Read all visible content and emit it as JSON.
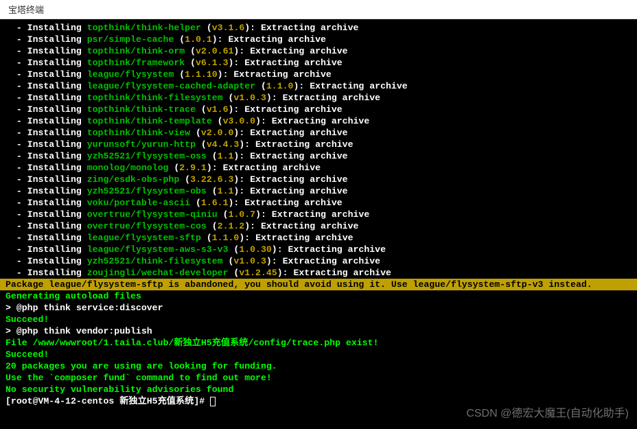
{
  "title": "宝塔终端",
  "installs": [
    {
      "pkg": "topthink/think-helper",
      "ver": "v3.1.6",
      "action": "Extracting archive"
    },
    {
      "pkg": "psr/simple-cache",
      "ver": "1.0.1",
      "action": "Extracting archive"
    },
    {
      "pkg": "topthink/think-orm",
      "ver": "v2.0.61",
      "action": "Extracting archive"
    },
    {
      "pkg": "topthink/framework",
      "ver": "v6.1.3",
      "action": "Extracting archive"
    },
    {
      "pkg": "league/flysystem",
      "ver": "1.1.10",
      "action": "Extracting archive"
    },
    {
      "pkg": "league/flysystem-cached-adapter",
      "ver": "1.1.0",
      "action": "Extracting archive"
    },
    {
      "pkg": "topthink/think-filesystem",
      "ver": "v1.0.3",
      "action": "Extracting archive"
    },
    {
      "pkg": "topthink/think-trace",
      "ver": "v1.6",
      "action": "Extracting archive"
    },
    {
      "pkg": "topthink/think-template",
      "ver": "v3.0.0",
      "action": "Extracting archive"
    },
    {
      "pkg": "topthink/think-view",
      "ver": "v2.0.0",
      "action": "Extracting archive"
    },
    {
      "pkg": "yurunsoft/yurun-http",
      "ver": "v4.4.3",
      "action": "Extracting archive"
    },
    {
      "pkg": "yzh52521/flysystem-oss",
      "ver": "1.1",
      "action": "Extracting archive"
    },
    {
      "pkg": "monolog/monolog",
      "ver": "2.9.1",
      "action": "Extracting archive"
    },
    {
      "pkg": "zing/esdk-obs-php",
      "ver": "3.22.6.3",
      "action": "Extracting archive"
    },
    {
      "pkg": "yzh52521/flysystem-obs",
      "ver": "1.1",
      "action": "Extracting archive"
    },
    {
      "pkg": "voku/portable-ascii",
      "ver": "1.6.1",
      "action": "Extracting archive"
    },
    {
      "pkg": "overtrue/flysystem-qiniu",
      "ver": "1.0.7",
      "action": "Extracting archive"
    },
    {
      "pkg": "overtrue/flysystem-cos",
      "ver": "2.1.2",
      "action": "Extracting archive"
    },
    {
      "pkg": "league/flysystem-sftp",
      "ver": "1.1.0",
      "action": "Extracting archive"
    },
    {
      "pkg": "league/flysystem-aws-s3-v3",
      "ver": "1.0.30",
      "action": "Extracting archive"
    },
    {
      "pkg": "yzh52521/think-filesystem",
      "ver": "v1.0.3",
      "action": "Extracting archive"
    },
    {
      "pkg": "zoujingli/wechat-developer",
      "ver": "v1.2.45",
      "action": "Extracting archive"
    }
  ],
  "warning": "Package league/flysystem-sftp is abandoned, you should avoid using it. Use league/flysystem-sftp-v3 instead.",
  "post_lines": {
    "gen_autoload": "Generating autoload files",
    "cmd1": "> @php think service:discover",
    "succeed1": "Succeed!",
    "cmd2": "> @php think vendor:publish",
    "file_exist": "File /www/wwwroot/1.taila.club/新独立H5充值系统/config/trace.php exist!",
    "succeed2": "Succeed!",
    "funding": "20 packages you are using are looking for funding.",
    "fund_cmd": "Use the `composer fund` command to find out more!",
    "no_vuln": "No security vulnerability advisories found"
  },
  "prompt": {
    "user_host": "root@VM-4-12-centos",
    "path": "新独立H5充值系统",
    "full": "[root@VM-4-12-centos 新独立H5充值系统]# "
  },
  "watermark": "CSDN @德宏大魔王(自动化助手)"
}
